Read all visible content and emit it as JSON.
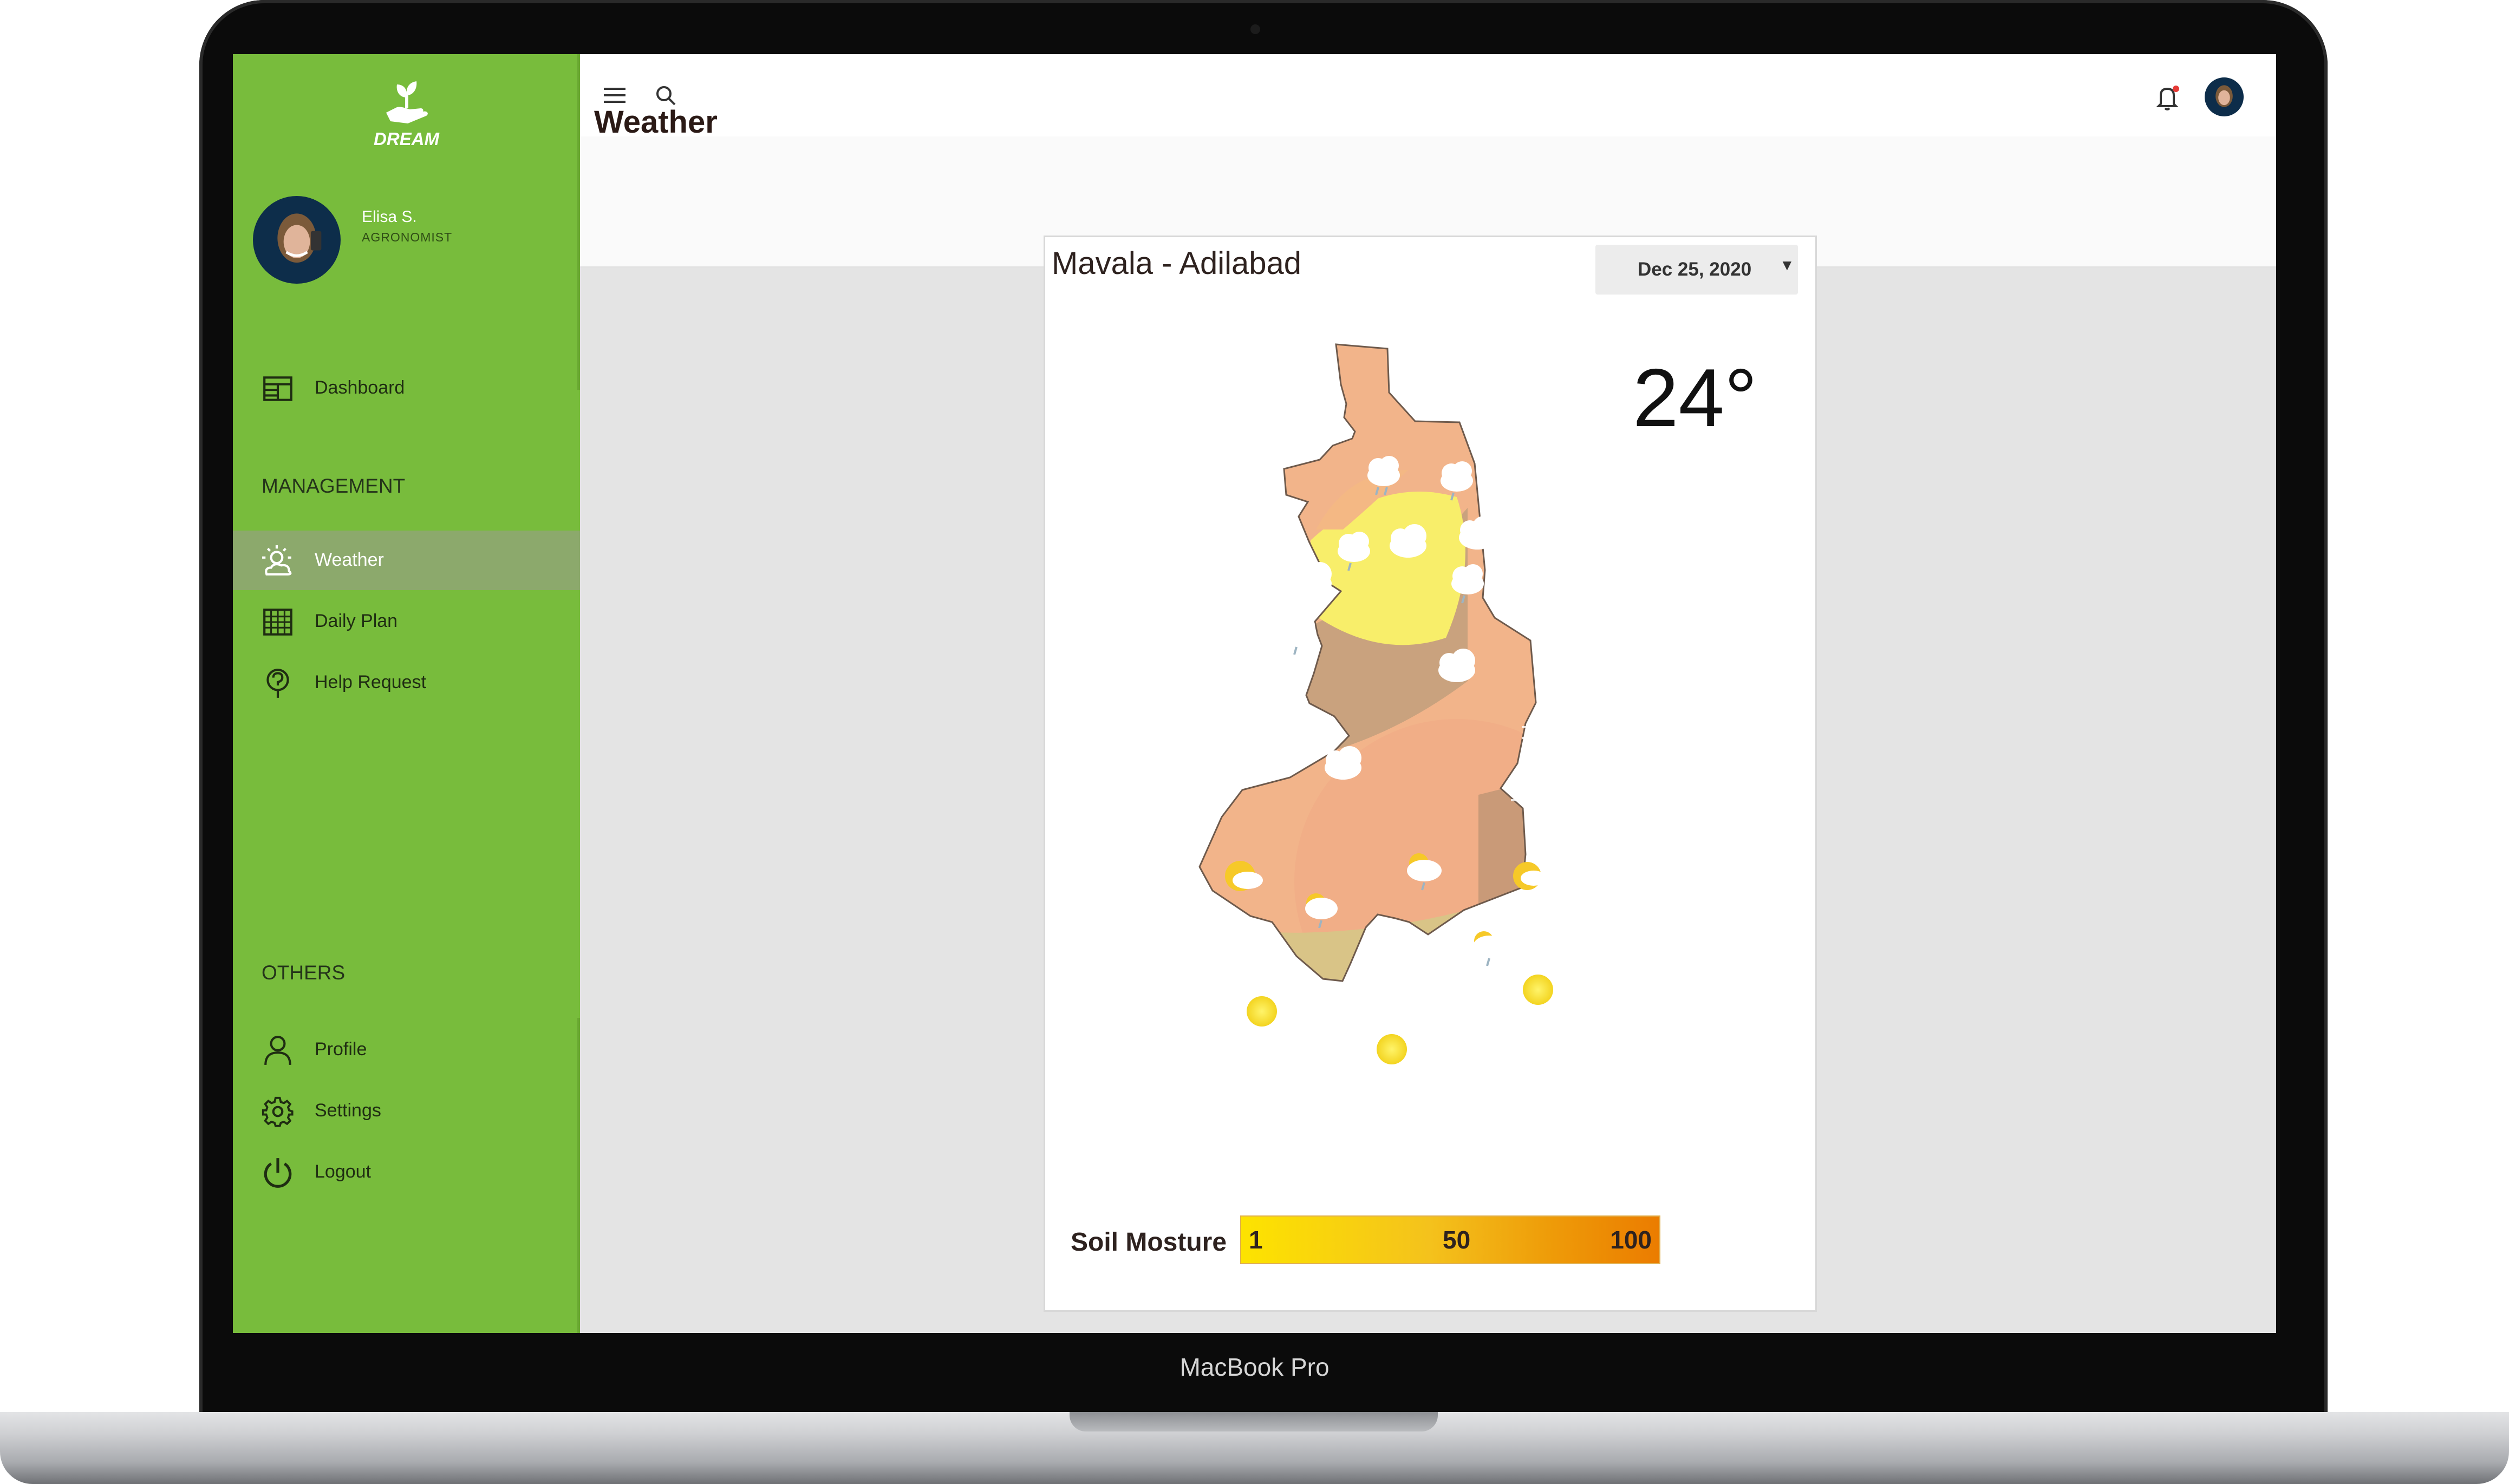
{
  "device": {
    "label": "MacBook Pro"
  },
  "brand": {
    "name": "DREAM",
    "color": "#78bc3c"
  },
  "user": {
    "name": "Elisa S.",
    "role": "AGRONOMIST"
  },
  "sidebar": {
    "items": [
      {
        "label": "Dashboard",
        "icon": "dashboard-icon"
      },
      {
        "label": "Weather",
        "icon": "weather-icon",
        "active": true
      },
      {
        "label": "Daily Plan",
        "icon": "calendar-grid-icon"
      },
      {
        "label": "Help Request",
        "icon": "help-icon"
      },
      {
        "label": "Profile",
        "icon": "user-icon"
      },
      {
        "label": "Settings",
        "icon": "gear-icon"
      },
      {
        "label": "Logout",
        "icon": "power-icon"
      }
    ],
    "sections": {
      "management": "MANAGEMENT",
      "others": "OTHERS"
    }
  },
  "header": {
    "page_title": "Weather"
  },
  "weather": {
    "location": "Mavala - Adilabad",
    "date": "Dec 25, 2020",
    "temperature": "24°",
    "legend": {
      "label": "Soil Mosture",
      "min": "1",
      "mid": "50",
      "max": "100",
      "colors": [
        "#fde300",
        "#eb7c00"
      ]
    }
  },
  "colors": {
    "accent": "#78bc3c",
    "active_item": "#8ca96c",
    "notification_dot": "#e53935"
  }
}
